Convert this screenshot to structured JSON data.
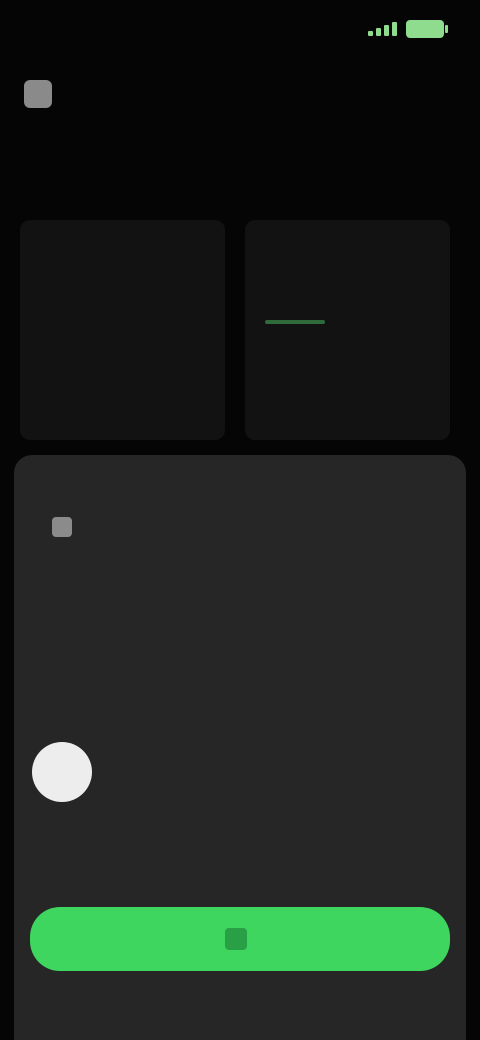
{
  "status_bar": {
    "time": "",
    "icons": [
      "signal-icon",
      "battery-icon"
    ],
    "accent_color": "#8fdc8f"
  },
  "header": {
    "back_icon": "back-arrow-icon",
    "title": ""
  },
  "tabs": [
    {
      "label": ""
    },
    {
      "label": ""
    },
    {
      "label": ""
    }
  ],
  "stats": [
    {
      "label": "",
      "value": ""
    },
    {
      "label": "",
      "value": "",
      "accent_color": "#2f6b3a"
    }
  ],
  "sheet": {
    "label": "",
    "icon": "asset-icon",
    "subtitle": "",
    "amount": "",
    "unit": "",
    "chips": [
      {
        "label": ""
      },
      {
        "label": ""
      },
      {
        "label": ""
      },
      {
        "label": ""
      }
    ],
    "footer_left": "",
    "footer_right": ""
  },
  "cta": {
    "label": "",
    "icon": "action-icon",
    "color": "#3ed65e"
  }
}
